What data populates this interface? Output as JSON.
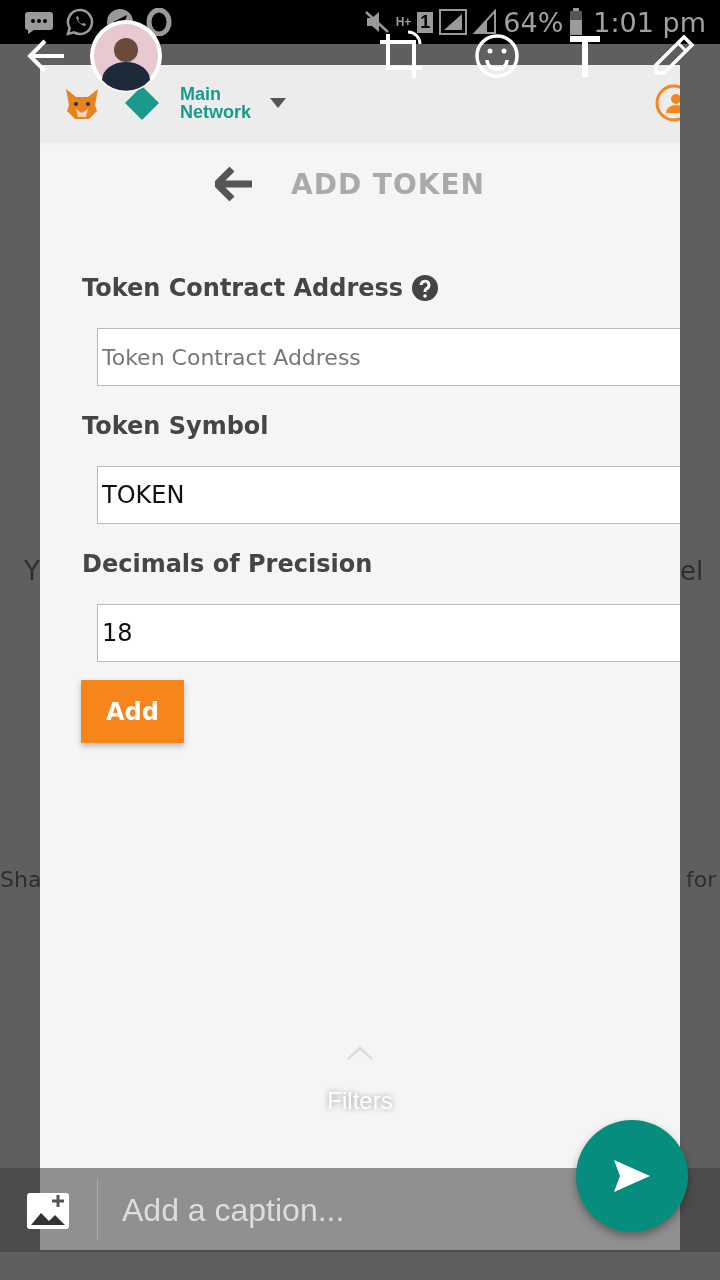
{
  "status_bar": {
    "network": "H+",
    "sim": "1",
    "battery": "64%",
    "time": "1:01 pm"
  },
  "background_text": {
    "left": [
      "Y",
      "Sha"
    ],
    "right": [
      "el",
      "for"
    ]
  },
  "screenshot": {
    "network": {
      "label": "Main Network"
    },
    "title": "ADD TOKEN",
    "fields": [
      {
        "label": "Token Contract Address",
        "help": true,
        "placeholder": "Token Contract Address"
      },
      {
        "label": "Token Symbol",
        "help": false,
        "value": "TOKEN"
      },
      {
        "label": "Decimals of Precision",
        "help": false,
        "value": "18"
      }
    ],
    "button": "Add"
  },
  "filters": {
    "label": "Filters"
  },
  "caption": {
    "placeholder": "Add a caption..."
  }
}
